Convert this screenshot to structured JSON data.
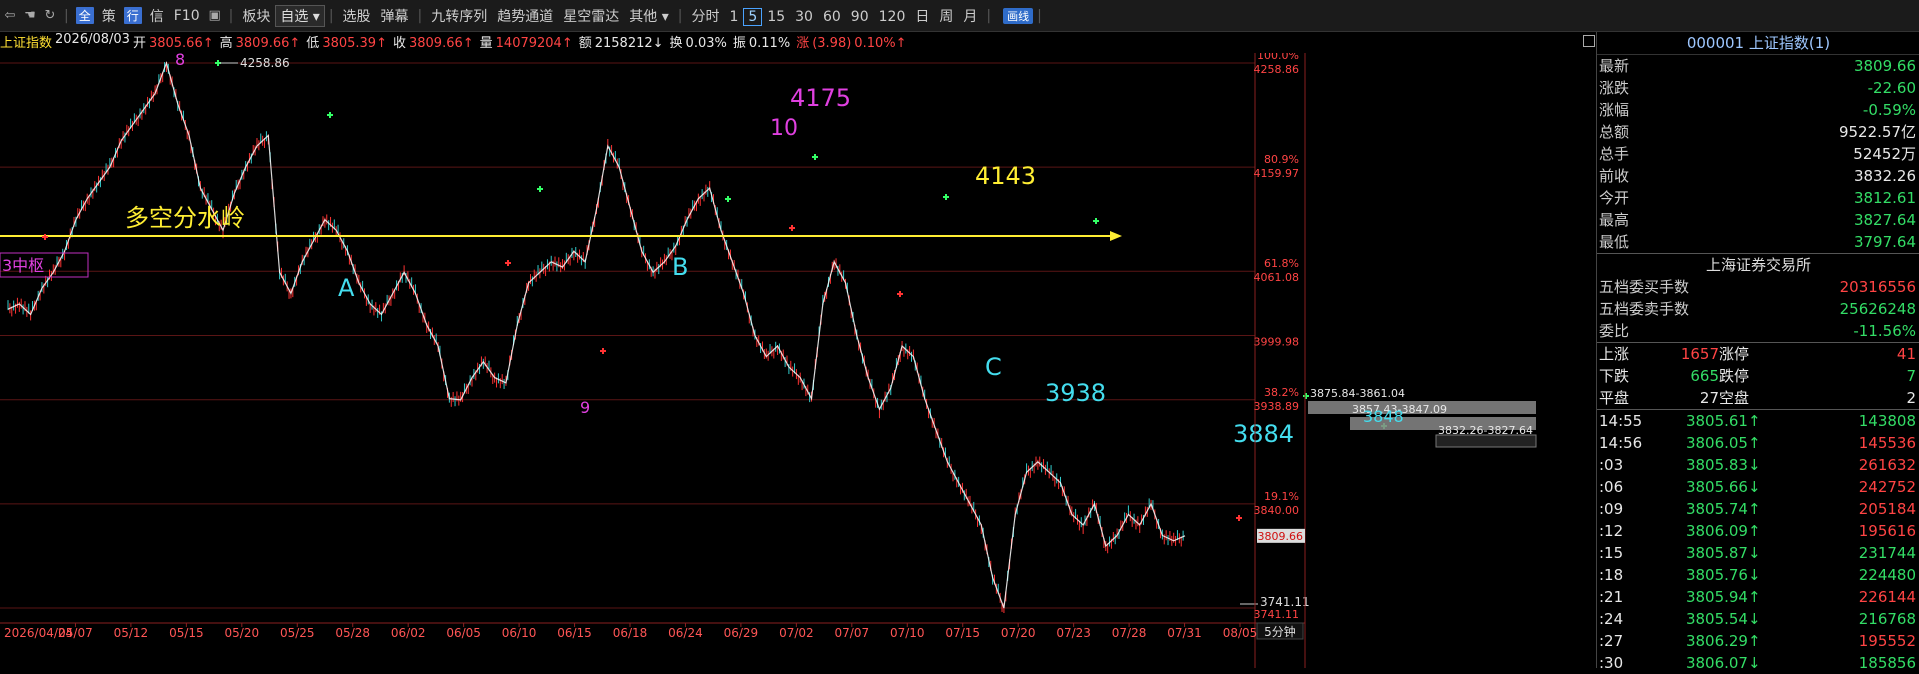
{
  "toolbar": {
    "items": [
      {
        "label": "全",
        "badge": true
      },
      {
        "label": "策"
      },
      {
        "label": "行",
        "badge": true
      },
      {
        "label": "信"
      },
      {
        "label": "F10"
      },
      {
        "label": "板块"
      },
      {
        "label": "自选",
        "dropdown": true
      },
      {
        "label": "选股"
      },
      {
        "label": "弹幕"
      },
      {
        "label": "九转序列"
      },
      {
        "label": "趋势通道"
      },
      {
        "label": "星空雷达"
      },
      {
        "label": "其他"
      }
    ],
    "periods": [
      "分时",
      "1",
      "5",
      "15",
      "30",
      "60",
      "90",
      "120",
      "日",
      "周",
      "月"
    ],
    "active_period": "5",
    "draw_label": "画线"
  },
  "quote": {
    "name": "上证指数",
    "date": "2026/08/03",
    "open_label": "开",
    "open": "3805.66↑",
    "high_label": "高",
    "high": "3809.66↑",
    "low_label": "低",
    "low": "3805.39↑",
    "close_label": "收",
    "close": "3809.66↑",
    "vol_label": "量",
    "vol": "14079204↑",
    "amt_label": "额",
    "amt": "2158212↓",
    "turn_label": "换",
    "turn": "0.03%",
    "amp_label": "振",
    "amp": "0.11%",
    "chg_label": "涨",
    "chg": "(3.98)",
    "chg_pct": "0.10%↑"
  },
  "chart_data": {
    "type": "line",
    "y_range": [
      3741.11,
      4258.86
    ],
    "x_labels": [
      "2026/04/24",
      "05/07",
      "05/12",
      "05/15",
      "05/20",
      "05/25",
      "05/28",
      "06/02",
      "06/05",
      "06/10",
      "06/15",
      "06/18",
      "06/24",
      "06/29",
      "07/02",
      "07/07",
      "07/10",
      "07/15",
      "07/20",
      "07/23",
      "07/28",
      "07/31",
      "08/05"
    ],
    "period_label": "5分钟",
    "right_axis": [
      {
        "pct": "100.0%",
        "price": "4258.86"
      },
      {
        "pct": "80.9%",
        "price": "4159.97"
      },
      {
        "pct": "61.8%",
        "price": "4061.08"
      },
      {
        "pct": "",
        "price": "3999.98"
      },
      {
        "pct": "38.2%",
        "price": "3938.89"
      },
      {
        "pct": "19.1%",
        "price": "3840.00"
      },
      {
        "pct": "",
        "price": "3741.11"
      }
    ],
    "current_price": "3809.66",
    "series": [
      {
        "values": [
          4025,
          4030,
          4020,
          4045,
          4060,
          4080,
          4110,
          4130,
          4145,
          4160,
          4185,
          4200,
          4215,
          4230,
          4258.86,
          4220,
          4190,
          4140,
          4120,
          4100,
          4135,
          4160,
          4180,
          4190,
          4060,
          4040,
          4070,
          4090,
          4110,
          4100,
          4080,
          4050,
          4030,
          4020,
          4040,
          4060,
          4040,
          4010,
          3990,
          3940,
          3938.89,
          3960,
          3975,
          3960,
          3955,
          4010,
          4050,
          4060,
          4070,
          4065,
          4080,
          4070,
          4120,
          4180,
          4160,
          4120,
          4080,
          4060,
          4070,
          4085,
          4110,
          4130,
          4140,
          4100,
          4070,
          4040,
          4000,
          3980,
          3990,
          3970,
          3960,
          3940,
          4030,
          4070,
          4050,
          4000,
          3960,
          3930,
          3950,
          3990,
          3980,
          3940,
          3910,
          3880,
          3860,
          3840,
          3820,
          3770,
          3741.11,
          3830,
          3870,
          3880,
          3870,
          3860,
          3830,
          3820,
          3840,
          3800,
          3810,
          3830,
          3820,
          3840,
          3810,
          3805,
          3809.66
        ]
      }
    ],
    "labels": {
      "w8": "8",
      "w8_price": "4258.86",
      "w10": "10",
      "w4175": "4175",
      "w4143": "4143",
      "divide": "多空分水岭",
      "a": "A",
      "b": "B",
      "c": "C",
      "w9": "9",
      "w3938": "3938",
      "w3884": "3884",
      "w3848": "3848",
      "box1": "3875.84-3861.04",
      "box2": "3857.43-3847.09",
      "box3": "3832.26-3827.64",
      "low_price": "3741.11",
      "left_box": "3中枢"
    }
  },
  "panel": {
    "code": "000001",
    "name": "上证指数(1)",
    "rows": [
      {
        "label": "最新",
        "value": "3809.66",
        "color": "green"
      },
      {
        "label": "涨跌",
        "value": "-22.60",
        "color": "green"
      },
      {
        "label": "涨幅",
        "value": "-0.59%",
        "color": "green"
      },
      {
        "label": "总额",
        "value": "9522.57亿",
        "color": "white"
      },
      {
        "label": "总手",
        "value": "52452万",
        "color": "white"
      },
      {
        "label": "前收",
        "value": "3832.26",
        "color": "white"
      },
      {
        "label": "今开",
        "value": "3812.61",
        "color": "green"
      },
      {
        "label": "最高",
        "value": "3827.64",
        "color": "green"
      },
      {
        "label": "最低",
        "value": "3797.64",
        "color": "green"
      }
    ],
    "exchange": "上海证券交易所",
    "rows2": [
      {
        "label": "五档委买手数",
        "value": "20316556",
        "color": "red"
      },
      {
        "label": "五档委卖手数",
        "value": "25626248",
        "color": "green"
      },
      {
        "label": "委比",
        "value": "-11.56%",
        "color": "green"
      }
    ],
    "stats": [
      {
        "l1": "上涨",
        "v1": "1657",
        "l2": "涨停",
        "v2": "41",
        "c": "red"
      },
      {
        "l1": "下跌",
        "v1": "665",
        "l2": "跌停",
        "v2": "7",
        "c": "green"
      },
      {
        "l1": "平盘",
        "v1": "27",
        "l2": "空盘",
        "v2": "2",
        "c": "white"
      }
    ],
    "ticks": [
      {
        "t": "14:55",
        "p": "3805.61↑",
        "v": "143808",
        "pc": "green",
        "vc": "green"
      },
      {
        "t": "14:56",
        "p": "3806.05↑",
        "v": "145536",
        "pc": "green",
        "vc": "red"
      },
      {
        "t": ":03",
        "p": "3805.83↓",
        "v": "261632",
        "pc": "green",
        "vc": "red"
      },
      {
        "t": ":06",
        "p": "3805.66↓",
        "v": "242752",
        "pc": "green",
        "vc": "red"
      },
      {
        "t": ":09",
        "p": "3805.74↑",
        "v": "205184",
        "pc": "green",
        "vc": "red"
      },
      {
        "t": ":12",
        "p": "3806.09↑",
        "v": "195616",
        "pc": "green",
        "vc": "red"
      },
      {
        "t": ":15",
        "p": "3805.87↓",
        "v": "231744",
        "pc": "green",
        "vc": "green"
      },
      {
        "t": ":18",
        "p": "3805.76↓",
        "v": "224480",
        "pc": "green",
        "vc": "green"
      },
      {
        "t": ":21",
        "p": "3805.94↑",
        "v": "226144",
        "pc": "green",
        "vc": "red"
      },
      {
        "t": ":24",
        "p": "3805.54↓",
        "v": "216768",
        "pc": "green",
        "vc": "green"
      },
      {
        "t": ":27",
        "p": "3806.29↑",
        "v": "195552",
        "pc": "green",
        "vc": "red"
      },
      {
        "t": ":30",
        "p": "3806.07↓",
        "v": "185856",
        "pc": "green",
        "vc": "green"
      }
    ]
  }
}
